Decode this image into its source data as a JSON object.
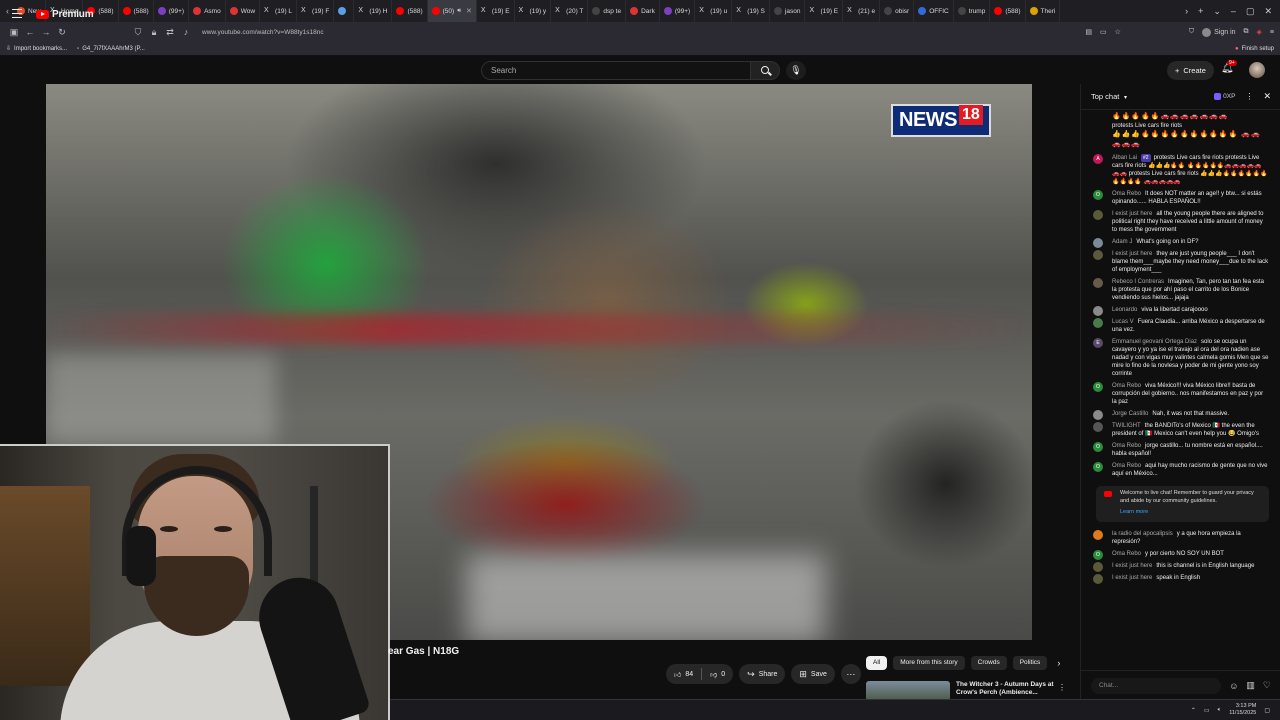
{
  "browser": {
    "tabs": [
      {
        "label": "New",
        "color": "#e44d26"
      },
      {
        "label": "Home",
        "color": "#222222",
        "icon": "x-icon"
      },
      {
        "label": "(588)",
        "color": "#ff0000"
      },
      {
        "label": "(588)",
        "color": "#ff0000"
      },
      {
        "label": "(99+)",
        "color": "#7b3fbf"
      },
      {
        "label": "Asmo",
        "color": "#d33"
      },
      {
        "label": "Wow",
        "color": "#d33"
      },
      {
        "label": "(19) L",
        "color": "#222222",
        "icon": "x-icon"
      },
      {
        "label": "(19) F",
        "color": "#222222",
        "icon": "x-icon"
      },
      {
        "label": "",
        "color": "#5aa0e6"
      },
      {
        "label": "(19) H",
        "color": "#222222",
        "icon": "x-icon"
      },
      {
        "label": "(588)",
        "color": "#ff0000"
      },
      {
        "label": "(50)",
        "color": "#ff0000",
        "active": true
      },
      {
        "label": "(19) E",
        "color": "#222222",
        "icon": "x-icon"
      },
      {
        "label": "(19) y",
        "color": "#222222",
        "icon": "x-icon"
      },
      {
        "label": "(20) T",
        "color": "#222222",
        "icon": "x-icon"
      },
      {
        "label": "dsp te",
        "color": "#444"
      },
      {
        "label": "Dark",
        "color": "#d33"
      },
      {
        "label": "(99+)",
        "color": "#7b3fbf"
      },
      {
        "label": "(19) u",
        "color": "#222222",
        "icon": "x-icon"
      },
      {
        "label": "(19) S",
        "color": "#222222",
        "icon": "x-icon"
      },
      {
        "label": "jason",
        "color": "#444"
      },
      {
        "label": "(19) E",
        "color": "#222222",
        "icon": "x-icon"
      },
      {
        "label": "(21) e",
        "color": "#222222",
        "icon": "x-icon"
      },
      {
        "label": "obisr",
        "color": "#444"
      },
      {
        "label": "OFFIC",
        "color": "#2f6bdc"
      },
      {
        "label": "trump",
        "color": "#444"
      },
      {
        "label": "(588)",
        "color": "#ff0000"
      },
      {
        "label": "Theri",
        "color": "#e0a000"
      }
    ],
    "url": "www.youtube.com/watch?v=W88ty1s18nc",
    "sign_in": "Sign in",
    "bookmarks": [
      "Import bookmarks...",
      "G4_7i7fXAAAhrM3 (P..."
    ],
    "finish_setup": "Finish setup"
  },
  "youtube": {
    "logo_text": "Premium",
    "search_placeholder": "Search",
    "create_label": "Create",
    "notif_badge": "9+",
    "video_title_partial": "ear Gas | N18G",
    "channel_logo_text": "NEWS",
    "channel_logo_num": "18",
    "likes": "84",
    "dislikes": "0",
    "share_label": "Share",
    "save_label": "Save",
    "chips": [
      "All",
      "More from this story",
      "Crowds",
      "Politics"
    ],
    "reco_title": "The Witcher 3 - Autumn Days at Crow's Perch (Ambience..."
  },
  "chat": {
    "header": "Top chat",
    "xp": "0XP",
    "input_placeholder": "Chat...",
    "messages": [
      {
        "author": "",
        "text": "protests Live cars fire riots",
        "emojis_before": "🔥🔥🔥🔥🔥🚗🚗🚗🚗🚗🚗🚗",
        "emojis_after": "👍👍👍🔥🔥🔥🔥🔥🔥🔥🔥🔥🔥 🚗🚗🚗🚗🚗",
        "avatar_color": "#00000000"
      },
      {
        "author": "Alban Lai",
        "badge": "#2",
        "text": "protests Live cars fire riots protests Live cars fire riots 👍👍👍🔥🔥 🔥🔥🔥🔥🔥🚗🚗🚗🚗🚗🚗🚗 protests Live cars fire riots 👍👍👍🔥🔥🔥🔥🔥🔥🔥🔥🔥🔥 🚗🚗🚗🚗🚗",
        "avatar_color": "#c2185b",
        "avatar_letter": "A"
      },
      {
        "author": "Oma Rebo",
        "text": "It does NOT matter an age!! y btw... si estás opinando...... HABLA ESPAÑOL!!",
        "avatar_color": "#2b8c3a",
        "avatar_letter": "O"
      },
      {
        "author": "I exist just here",
        "text": "all the young people there are aligned to political right they have received a little amount of money to mess the government",
        "avatar_color": "#5a5a3a"
      },
      {
        "author": "Adam J",
        "text": "What's going on in DF?",
        "avatar_color": "#7a8a9a"
      },
      {
        "author": "I exist just here",
        "text": "they are just young people___ I don't blame them___maybe they need money___due to the lack of employment___",
        "avatar_color": "#5a5a3a"
      },
      {
        "author": "Rebeco I Contreras",
        "text": "Imaginen, Tan, pero tan tan fea esta la protesta que por ahí paso el carrito de los Bonice vendiendo sus hielos... jajaja",
        "avatar_color": "#6a5a4a"
      },
      {
        "author": "Leonardo",
        "text": "viva la libertad carajoooo",
        "avatar_color": "#8a8a8a"
      },
      {
        "author": "Lucas V",
        "text": "Fuera Claudia... arriba México a despertarse de una vez.",
        "avatar_color": "#4a7a4a"
      },
      {
        "author": "Emmanuel geovani Ortega Diaz",
        "text": "solo se ocupa un cavayero y yo ya ise el travajo al ora del ora nadien ase nadad y con vigas muy valintes calmela gomis Men que se mire lo fino de la novlesa y poder de mi gente yono soy corrinte",
        "avatar_color": "#5a4a6a",
        "avatar_letter": "E"
      },
      {
        "author": "Oma Rebo",
        "text": "viva México!!! viva México libre!! basta de corrupción del gobierno.. nos manifestamos en paz y por la paz",
        "avatar_color": "#2b8c3a",
        "avatar_letter": "O"
      },
      {
        "author": "Jorge Castillo",
        "text": "Nah, it was not that massive.",
        "avatar_color": "#8a8a8a"
      },
      {
        "author": "TWILIGHT",
        "text": "the BANDITo's of Mexico 🇲🇽 the even the president of 🇲🇽 Mexico can't even help you 😂 Omigo's",
        "avatar_color": "#555"
      },
      {
        "author": "Oma Rebo",
        "text": "jorge castillo... tu nombre está en español.... habla español!",
        "avatar_color": "#2b8c3a",
        "avatar_letter": "O"
      },
      {
        "author": "Oma Rebo",
        "text": "aqui hay mucho racismo de gente que no vive aquí en México...",
        "avatar_color": "#2b8c3a",
        "avatar_letter": "O"
      }
    ],
    "welcome": "Welcome to live chat! Remember to guard your privacy and abide by our community guidelines.",
    "learn_more": "Learn more",
    "messages_after": [
      {
        "author": "la radio del apocalipsis",
        "text": "y a que hora empieza la represión?",
        "avatar_color": "#e07a1a"
      },
      {
        "author": "Oma Rebo",
        "text": "y por cierto NO SOY UN BOT",
        "avatar_color": "#2b8c3a",
        "avatar_letter": "O"
      },
      {
        "author": "I exist just here",
        "text": "this is channel is in English language",
        "avatar_color": "#5a5a3a"
      },
      {
        "author": "I exist just here",
        "text": "speak in English",
        "avatar_color": "#5a5a3a"
      }
    ]
  },
  "taskbar": {
    "time": "3:13 PM",
    "date": "11/15/2025"
  }
}
